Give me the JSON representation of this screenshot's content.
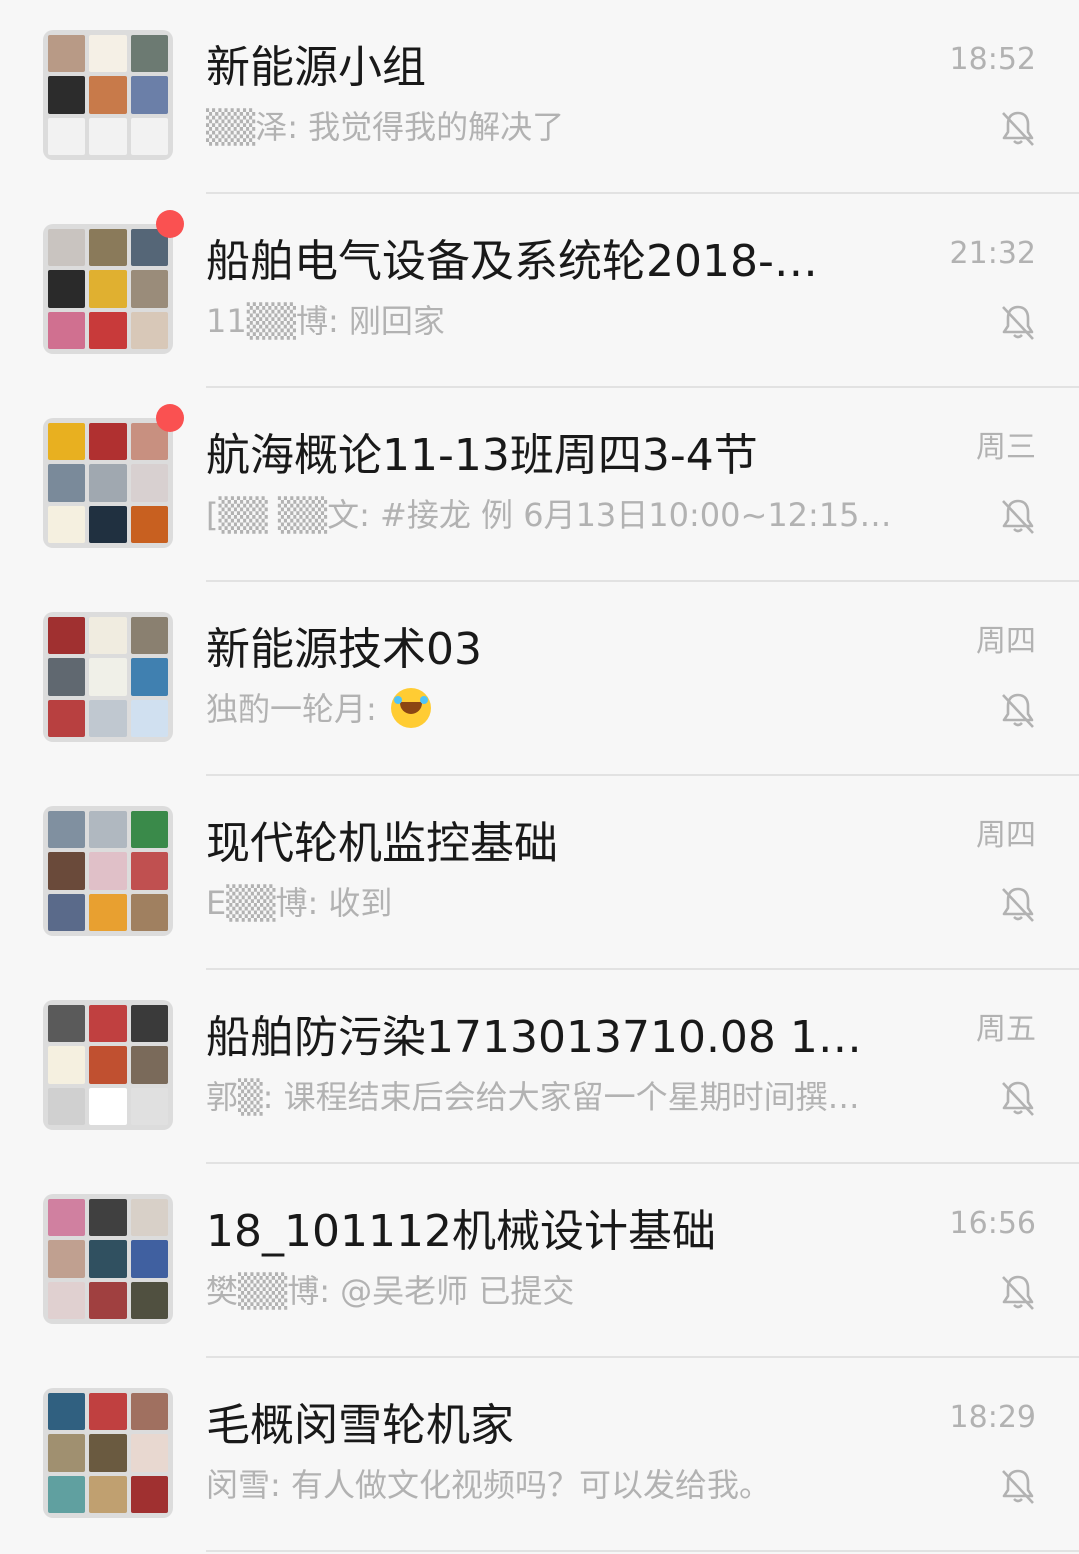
{
  "colors": {
    "background": "#f7f7f7",
    "title": "#191919",
    "muted_text": "#b2b2b2",
    "divider": "#e2e2e2",
    "unread_badge": "#fa5151"
  },
  "chats": [
    {
      "title": "新能源小组",
      "preview": "▒▒泽: 我觉得我的解决了",
      "time": "18:52",
      "unread": false,
      "muted_icon": "bell-off-icon",
      "avatar_colors": [
        "#b89a86",
        "#f5f0e6",
        "#6c7a72",
        "#2c2c2c",
        "#c87a4a",
        "#6b7fa8",
        "#f2f2f2",
        "#f2f2f2",
        "#f2f2f2"
      ]
    },
    {
      "title": "船舶电气设备及系统轮2018-…",
      "preview": "11▒▒博: 刚回家",
      "time": "21:32",
      "unread": true,
      "muted_icon": "bell-off-icon",
      "avatar_colors": [
        "#c9c4c0",
        "#8a7a5a",
        "#556677",
        "#2a2a2a",
        "#e0b030",
        "#9a8c7a",
        "#d07090",
        "#c83a3a",
        "#d8c8b8"
      ]
    },
    {
      "title": "航海概论11-13班周四3-4节",
      "preview": "[▒▒  ▒▒文: #接龙 例 6月13日10:00~12:15…",
      "time": "周三",
      "unread": true,
      "muted_icon": "bell-off-icon",
      "avatar_colors": [
        "#e8b020",
        "#b03030",
        "#c89080",
        "#7a8a9a",
        "#a0a8b0",
        "#d8d0d0",
        "#f5f0e0",
        "#203040",
        "#c86020"
      ]
    },
    {
      "title": "新能源技术03",
      "preview": "独酌一轮月: ",
      "has_emoji": true,
      "emoji_icon": "laughing-tears-emoji-icon",
      "time": "周四",
      "unread": false,
      "muted_icon": "bell-off-icon",
      "avatar_colors": [
        "#a03030",
        "#f0ece0",
        "#8a8070",
        "#606870",
        "#f0f0e8",
        "#4080b0",
        "#b84040",
        "#c0c8d0",
        "#d0e0f0"
      ]
    },
    {
      "title": "现代轮机监控基础",
      "preview": "E▒▒博: 收到",
      "time": "周四",
      "unread": false,
      "muted_icon": "bell-off-icon",
      "avatar_colors": [
        "#8090a0",
        "#b0b8c0",
        "#3a8a4a",
        "#6a4a3a",
        "#e0c0c8",
        "#c05050",
        "#5a6a8a",
        "#e8a030",
        "#a08060"
      ]
    },
    {
      "title": "船舶防污染1713013710.08 1…",
      "preview": "郭▒: 课程结束后会给大家留一个星期时间撰…",
      "time": "周五",
      "unread": false,
      "muted_icon": "bell-off-icon",
      "avatar_colors": [
        "#5a5a5a",
        "#c04040",
        "#3a3a3a",
        "#f5f0e0",
        "#c05030",
        "#7a6a5a",
        "#d0d0d0",
        "#ffffff",
        "#e0e0e0"
      ]
    },
    {
      "title": "18_101112机械设计基础",
      "preview": "樊▒▒博: @吴老师 已提交",
      "time": "16:56",
      "unread": false,
      "muted_icon": "bell-off-icon",
      "avatar_colors": [
        "#d080a0",
        "#404040",
        "#d8d0c8",
        "#c0a090",
        "#305060",
        "#4060a0",
        "#e0d0d0",
        "#a04040",
        "#505040"
      ]
    },
    {
      "title": "毛概闵雪轮机家",
      "preview": "闵雪: 有人做文化视频吗？可以发给我。",
      "time": "18:29",
      "unread": false,
      "muted_icon": "bell-off-icon",
      "avatar_colors": [
        "#306080",
        "#c04040",
        "#a07060",
        "#a09070",
        "#6a5a40",
        "#e8d8d0",
        "#60a0a0",
        "#c0a070",
        "#a03030"
      ]
    }
  ]
}
